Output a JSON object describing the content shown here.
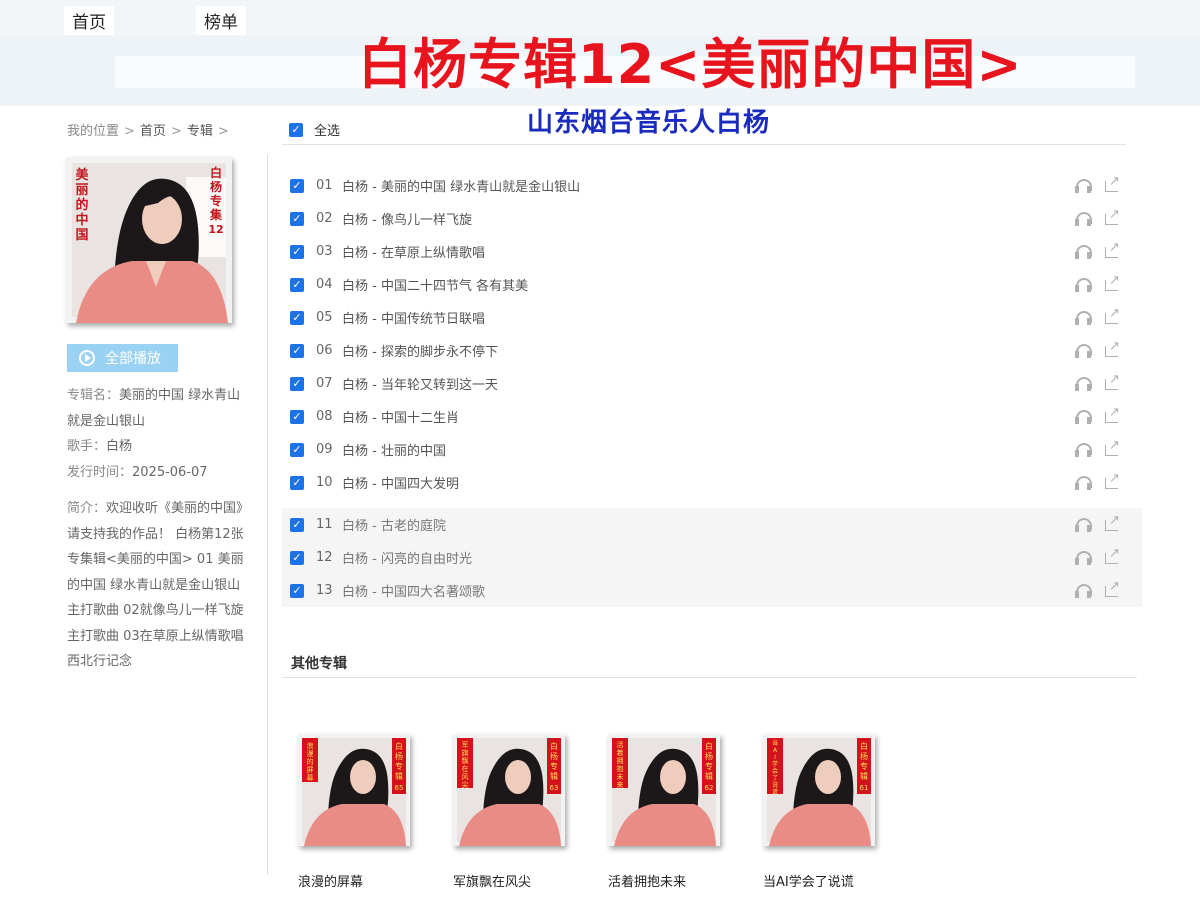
{
  "nav": {
    "home": "首页",
    "charts": "榜单"
  },
  "banner": {
    "title": "白杨专辑12<美丽的中国>",
    "subtitle": "山东烟台音乐人白杨"
  },
  "breadcrumb": {
    "location": "我的位置",
    "home": "首页",
    "albums": "专辑",
    "sep": ">"
  },
  "cover": {
    "left_text": [
      "美",
      "丽",
      "的",
      "中",
      "国"
    ],
    "right_text": [
      "白",
      "杨",
      "专",
      "集",
      "12"
    ]
  },
  "play_all": {
    "label": "全部播放",
    "icon": "play-circle-icon"
  },
  "album_info": {
    "name_key": "专辑名：",
    "name_value": "美丽的中国 绿水青山就是金山银山",
    "artist_key": "歌手：",
    "artist_value": "白杨",
    "date_key": "发行时间：",
    "date_value": "2025-06-07",
    "intro_key": "简介：",
    "intro_value": "欢迎收听《美丽的中国》请支持我的作品！ 白杨第12张专集辑<美丽的中国> 01 美丽的中国 绿水青山就是金山银山 主打歌曲 02就像鸟儿一样飞旋 主打歌曲 03在草原上纵情歌唱 西北行记念"
  },
  "select_all": {
    "label": "全选",
    "checked": true
  },
  "songs": [
    {
      "num": "01",
      "title": "白杨 - 美丽的中国 绿水青山就是金山银山",
      "checked": true
    },
    {
      "num": "02",
      "title": "白杨 - 像鸟儿一样飞旋",
      "checked": true
    },
    {
      "num": "03",
      "title": "白杨 - 在草原上纵情歌唱",
      "checked": true
    },
    {
      "num": "04",
      "title": "白杨 - 中国二十四节气 各有其美",
      "checked": true
    },
    {
      "num": "05",
      "title": "白杨 - 中国传统节日联唱",
      "checked": true
    },
    {
      "num": "06",
      "title": "白杨 - 探索的脚步永不停下",
      "checked": true
    },
    {
      "num": "07",
      "title": "白杨 - 当年轮又转到这一天",
      "checked": true
    },
    {
      "num": "08",
      "title": "白杨 - 中国十二生肖",
      "checked": true
    },
    {
      "num": "09",
      "title": "白杨 - 壮丽的中国",
      "checked": true
    },
    {
      "num": "10",
      "title": "白杨 - 中国四大发明",
      "checked": true
    },
    {
      "num": "11",
      "title": "白杨 - 古老的庭院",
      "checked": true
    },
    {
      "num": "12",
      "title": "白杨 - 闪亮的自由时光",
      "checked": true
    },
    {
      "num": "13",
      "title": "白杨 - 中国四大名著颂歌",
      "checked": true
    }
  ],
  "row_icons": {
    "listen": "headphones-icon",
    "share": "share-icon"
  },
  "other_albums": {
    "title": "其他专辑",
    "items": [
      {
        "label": "浪漫的屏幕",
        "left_text": [
          "浪",
          "漫",
          "的",
          "屏",
          "幕"
        ],
        "right_text": [
          "白",
          "杨",
          "专",
          "辑",
          "65"
        ]
      },
      {
        "label": "军旗飘在风尖",
        "left_text": [
          "军",
          "旗",
          "飘",
          "在",
          "风",
          "尖"
        ],
        "right_text": [
          "白",
          "杨",
          "专",
          "辑",
          "63"
        ]
      },
      {
        "label": "活着拥抱未来",
        "left_text": [
          "活",
          "着",
          "拥",
          "抱",
          "未",
          "来"
        ],
        "right_text": [
          "白",
          "杨",
          "专",
          "辑",
          "62"
        ]
      },
      {
        "label": "当AI学会了说谎",
        "left_text": [
          "当",
          "A",
          "I",
          "学",
          "会",
          "了",
          "说",
          "谎"
        ],
        "right_text": [
          "白",
          "杨",
          "专",
          "辑",
          "61"
        ]
      }
    ]
  },
  "colors": {
    "title_red": "#e8141d",
    "subtitle_blue": "#1a2bbd",
    "checkbox_blue": "#1a73e8",
    "play_button": "#9ad2f3"
  }
}
